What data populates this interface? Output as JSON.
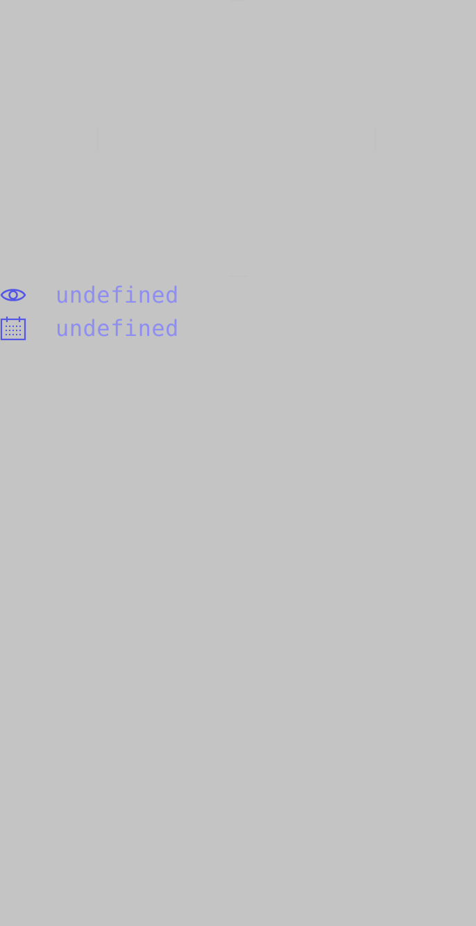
{
  "colors": {
    "background": "#c4c4c4",
    "icon": "#5457e6",
    "text": "#8e8ef2"
  },
  "meta": {
    "views": {
      "icon": "eye-icon",
      "value": "undefined"
    },
    "date": {
      "icon": "calendar-icon",
      "value": "undefined"
    }
  }
}
